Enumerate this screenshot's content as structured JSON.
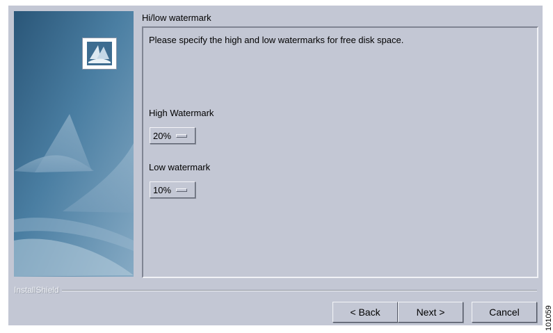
{
  "wizard": {
    "section_title": "Hi/low watermark",
    "instruction": "Please specify the high and low  watermarks for free disk space.",
    "high_watermark": {
      "label": "High Watermark",
      "selected": "20%"
    },
    "low_watermark": {
      "label": "Low watermark",
      "selected": "10%"
    }
  },
  "footer": {
    "brand": "InstallShield",
    "back_label": "< Back",
    "next_label": "Next >",
    "cancel_label": "Cancel"
  },
  "figure_code": "101059",
  "colors": {
    "dialog_bg": "#c3c7d4",
    "side_panel_dark": "#2e5f82",
    "side_panel_light": "#7fa6c2"
  }
}
